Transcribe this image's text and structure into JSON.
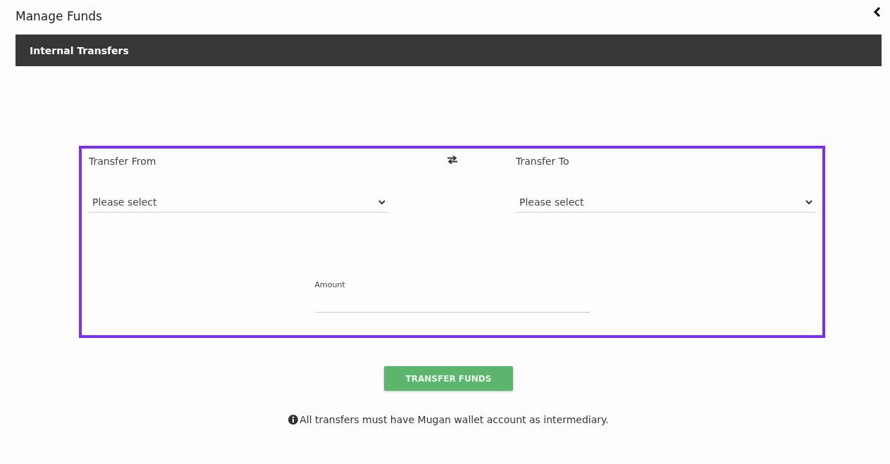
{
  "page_title": "Manage Funds",
  "section_bar": {
    "title": "Internal Transfers"
  },
  "transfer_from": {
    "label": "Transfer From",
    "placeholder": "Please select"
  },
  "transfer_to": {
    "label": "Transfer To",
    "placeholder": "Please select"
  },
  "amount": {
    "label": "Amount"
  },
  "submit_button": "TRANSFER FUNDS",
  "note": "All transfers must have Mugan wallet account as intermediary."
}
